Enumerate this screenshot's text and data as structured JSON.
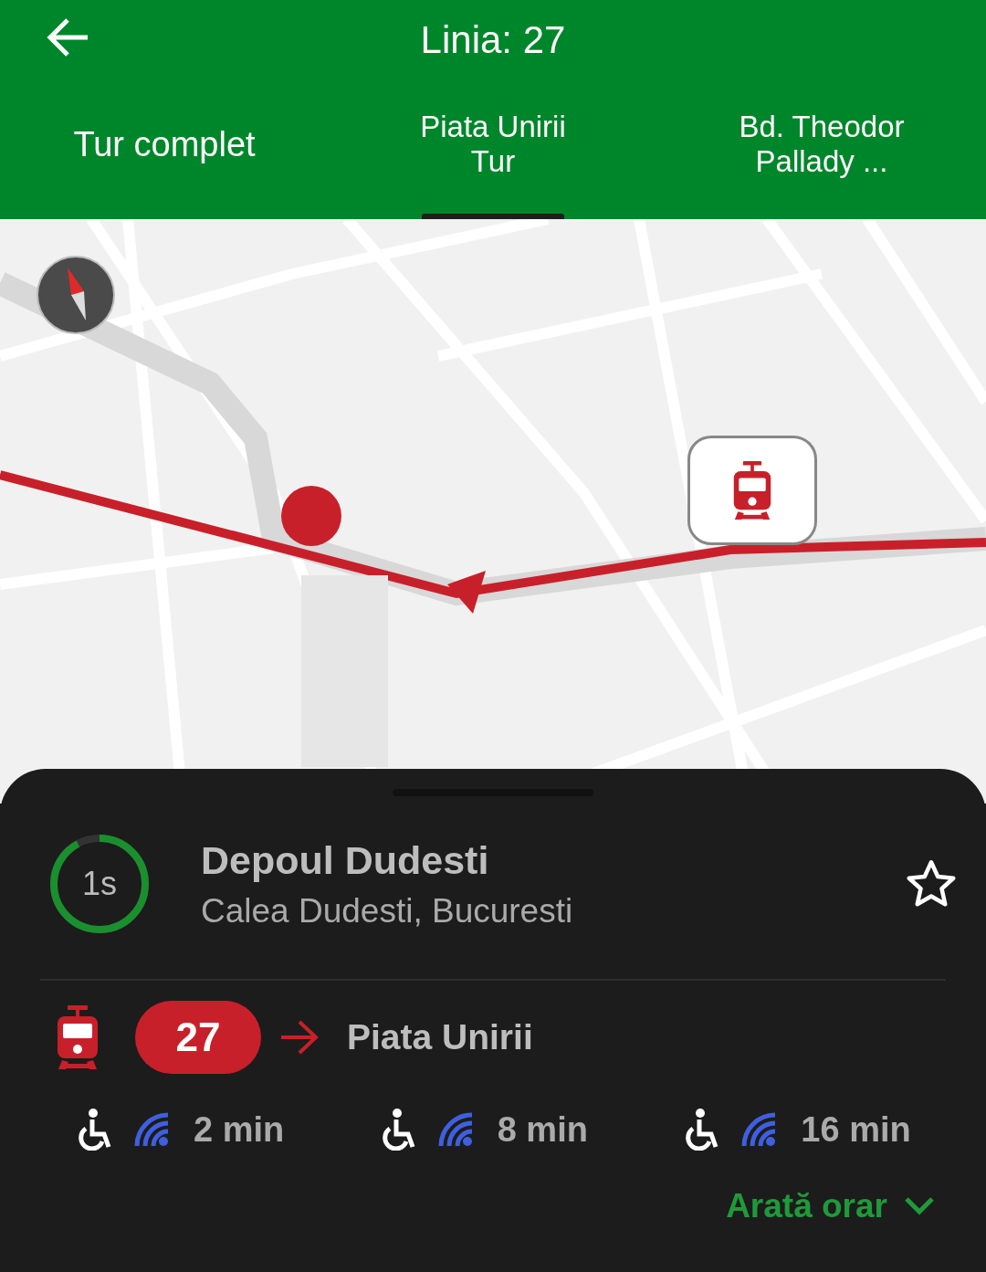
{
  "header": {
    "title": "Linia: 27"
  },
  "tabs": [
    {
      "lines": [
        "Tur complet"
      ],
      "selected": false
    },
    {
      "lines": [
        "Piata Unirii",
        "Tur"
      ],
      "selected": true
    },
    {
      "lines": [
        "Bd. Theodor",
        "Pallady ..."
      ],
      "selected": false
    }
  ],
  "stop": {
    "countdown": "1s",
    "level": 0.92,
    "name": "Depoul Dudesti",
    "address": "Calea Dudesti, Bucuresti",
    "favorite": false
  },
  "line": {
    "number": "27",
    "destination": "Piata Unirii"
  },
  "arrivals": [
    {
      "time": "2 min",
      "accessible": true,
      "realtime": true
    },
    {
      "time": "8 min",
      "accessible": true,
      "realtime": true
    },
    {
      "time": "16 min",
      "accessible": true,
      "realtime": true
    }
  ],
  "schedule_link": "Arată orar"
}
